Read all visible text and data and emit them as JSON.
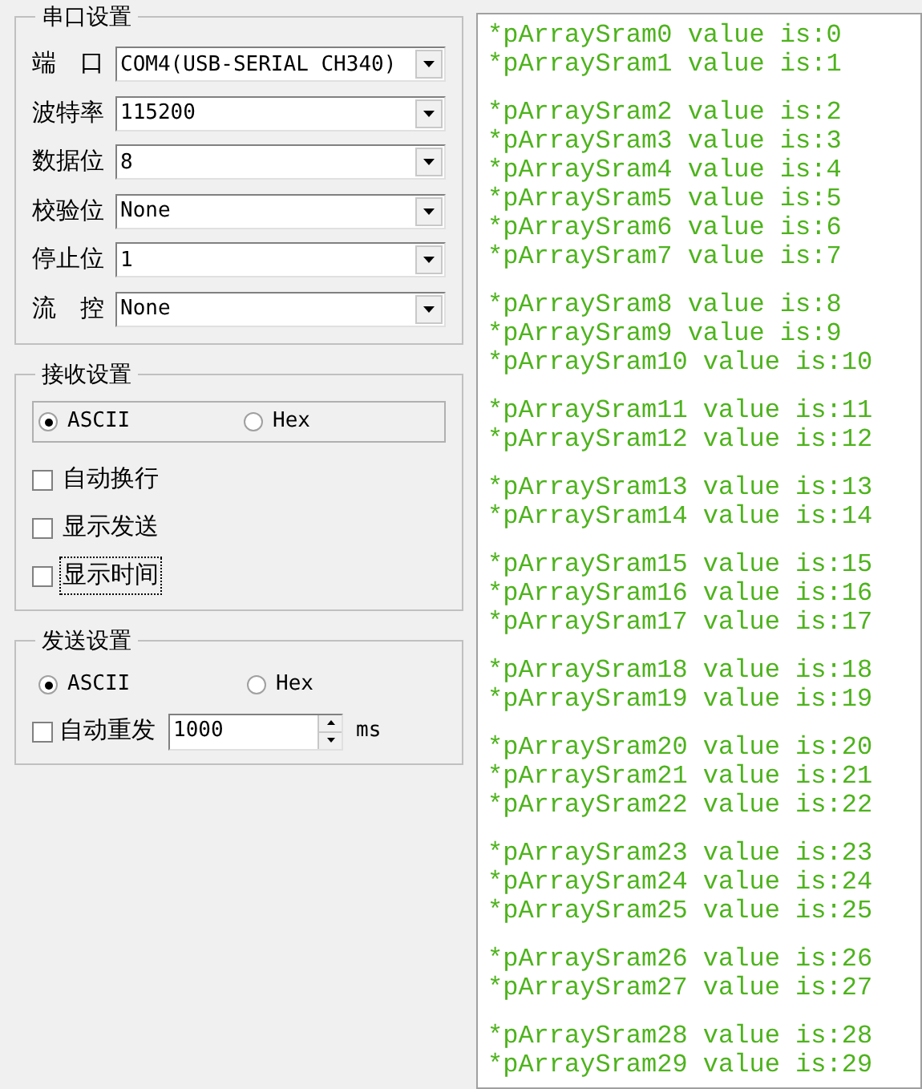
{
  "serial_settings": {
    "title": "串口设置",
    "fields": [
      {
        "label": "端　口",
        "value": "COM4(USB-SERIAL CH340)"
      },
      {
        "label": "波特率",
        "value": "115200"
      },
      {
        "label": "数据位",
        "value": "8"
      },
      {
        "label": "校验位",
        "value": "None"
      },
      {
        "label": "停止位",
        "value": "1"
      },
      {
        "label": "流　控",
        "value": "None"
      }
    ]
  },
  "receive_settings": {
    "title": "接收设置",
    "modes": [
      {
        "label": "ASCII",
        "selected": true
      },
      {
        "label": "Hex",
        "selected": false
      }
    ],
    "options": [
      {
        "label": "自动换行",
        "checked": false,
        "focused": false
      },
      {
        "label": "显示发送",
        "checked": false,
        "focused": false
      },
      {
        "label": "显示时间",
        "checked": false,
        "focused": true
      }
    ]
  },
  "send_settings": {
    "title": "发送设置",
    "modes": [
      {
        "label": "ASCII",
        "selected": true
      },
      {
        "label": "Hex",
        "selected": false
      }
    ],
    "auto_resend": {
      "label": "自动重发",
      "checked": false,
      "value": "1000",
      "unit": "ms"
    }
  },
  "output": {
    "groups": [
      {
        "lines": [
          "*pArraySram0 value is:0",
          "*pArraySram1 value is:1"
        ]
      },
      {
        "lines": [
          "*pArraySram2 value is:2",
          "*pArraySram3 value is:3",
          "*pArraySram4 value is:4",
          "*pArraySram5 value is:5",
          "*pArraySram6 value is:6",
          "*pArraySram7 value is:7"
        ]
      },
      {
        "lines": [
          "*pArraySram8 value is:8",
          "*pArraySram9 value is:9",
          "*pArraySram10 value is:10"
        ]
      },
      {
        "lines": [
          "*pArraySram11 value is:11",
          "*pArraySram12 value is:12"
        ]
      },
      {
        "lines": [
          "*pArraySram13 value is:13",
          "*pArraySram14 value is:14"
        ]
      },
      {
        "lines": [
          "*pArraySram15 value is:15",
          "*pArraySram16 value is:16",
          "*pArraySram17 value is:17"
        ]
      },
      {
        "lines": [
          "*pArraySram18 value is:18",
          "*pArraySram19 value is:19"
        ]
      },
      {
        "lines": [
          "*pArraySram20 value is:20",
          "*pArraySram21 value is:21",
          "*pArraySram22 value is:22"
        ]
      },
      {
        "lines": [
          "*pArraySram23 value is:23",
          "*pArraySram24 value is:24",
          "*pArraySram25 value is:25"
        ]
      },
      {
        "lines": [
          "*pArraySram26 value is:26",
          "*pArraySram27 value is:27"
        ]
      },
      {
        "lines": [
          "*pArraySram28 value is:28",
          "*pArraySram29 value is:29"
        ]
      }
    ]
  }
}
